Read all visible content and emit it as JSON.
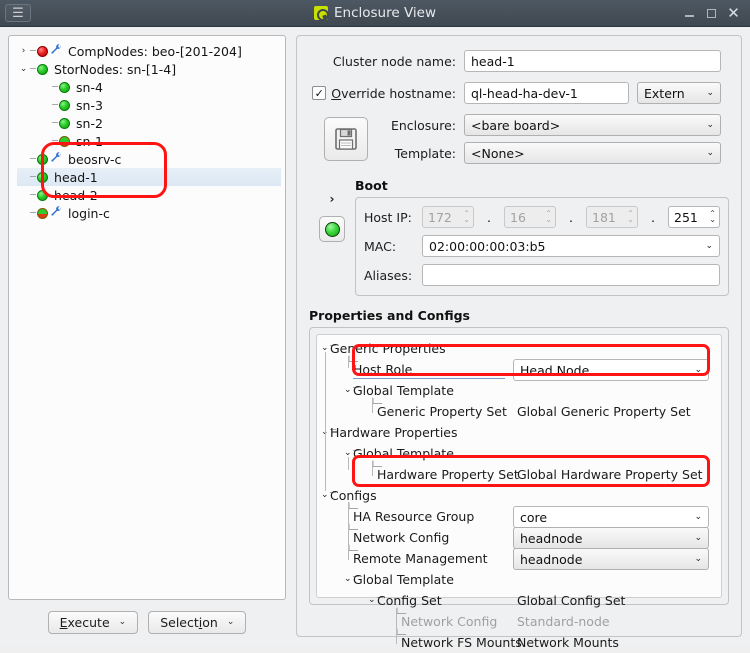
{
  "window": {
    "title": "Enclosure View",
    "app_icon": "qt-logo-icon",
    "menu_icon": "hamburger-menu-icon",
    "minimize_label": "_",
    "maximize_label": "□",
    "close_label": "✕"
  },
  "tree": {
    "nodes": [
      {
        "label": "CompNodes: beo-[201-204]",
        "arrow": "›",
        "led": "red",
        "wrench": true,
        "depth": 0,
        "selected": false
      },
      {
        "label": "StorNodes: sn-[1-4]",
        "arrow": "⌄",
        "led": "green",
        "wrench": false,
        "depth": 0,
        "selected": false
      },
      {
        "label": "sn-4",
        "arrow": "",
        "led": "green",
        "wrench": false,
        "depth": 1,
        "selected": false
      },
      {
        "label": "sn-3",
        "arrow": "",
        "led": "green",
        "wrench": false,
        "depth": 1,
        "selected": false
      },
      {
        "label": "sn-2",
        "arrow": "",
        "led": "green",
        "wrench": false,
        "depth": 1,
        "selected": false
      },
      {
        "label": "sn-1",
        "arrow": "",
        "led": "half",
        "wrench": false,
        "depth": 1,
        "selected": false
      },
      {
        "label": "beosrv-c",
        "arrow": "",
        "led": "green",
        "wrench": true,
        "depth": 0,
        "selected": false
      },
      {
        "label": "head-1",
        "arrow": "",
        "led": "green",
        "wrench": false,
        "depth": 0,
        "selected": true
      },
      {
        "label": "head-2",
        "arrow": "",
        "led": "green",
        "wrench": false,
        "depth": 0,
        "selected": false
      },
      {
        "label": "login-c",
        "arrow": "",
        "led": "half",
        "wrench": true,
        "depth": 0,
        "selected": false
      }
    ],
    "buttons": {
      "execute": "Execute",
      "execute_mnemonic": "E",
      "selection": "Selection",
      "selection_mnemonic": "i",
      "caret": "⌄"
    }
  },
  "form": {
    "cluster_node_name_label": "Cluster node name:",
    "cluster_node_name_value": "head-1",
    "override_hostname_label": "Override hostname:",
    "override_hostname_mnemonic": "O",
    "override_hostname_checked": "✓",
    "override_hostname_value": "ql-head-ha-dev-1",
    "override_scope_value": "Extern",
    "save_icon": "floppy-disk-save-icon",
    "enclosure_label": "Enclosure:",
    "enclosure_value": "<bare board>",
    "template_label": "Template:",
    "template_value": "<None>",
    "chevron": "⌄"
  },
  "boot": {
    "group_title": "Boot",
    "expand_arrow": "›",
    "status_led": "green-led-indicator",
    "host_ip_label": "Host IP:",
    "host_ip_octets": [
      {
        "value": "172",
        "disabled": true
      },
      {
        "value": "16",
        "disabled": true
      },
      {
        "value": "181",
        "disabled": true
      },
      {
        "value": "251",
        "disabled": false
      }
    ],
    "ip_separator": ".",
    "mac_label": "MAC:",
    "mac_value": "02:00:00:00:03:b5",
    "aliases_label": "Aliases:",
    "aliases_value": "",
    "spin_up": "⌃",
    "spin_down": "⌄"
  },
  "properties": {
    "section_title": "Properties and Configs",
    "rows": [
      {
        "kind": "branch",
        "name": "Generic Properties",
        "value": "",
        "depth": 0,
        "chevron": "⌄",
        "grey": false
      },
      {
        "kind": "editor",
        "name": "Host Role",
        "value": "Head Node",
        "depth": 1,
        "chevron": "",
        "grey": false,
        "combo": "white"
      },
      {
        "kind": "branch",
        "name": "Global Template",
        "value": "",
        "depth": 1,
        "chevron": "⌄",
        "grey": false
      },
      {
        "kind": "leaf",
        "name": "Generic Property Set",
        "value": "Global Generic Property Set",
        "depth": 2,
        "chevron": "",
        "grey": false
      },
      {
        "kind": "branch",
        "name": "Hardware Properties",
        "value": "",
        "depth": 0,
        "chevron": "⌄",
        "grey": false
      },
      {
        "kind": "branch",
        "name": "Global Template",
        "value": "",
        "depth": 1,
        "chevron": "⌄",
        "grey": false
      },
      {
        "kind": "leaf",
        "name": "Hardware Property Set",
        "value": "Global Hardware Property Set",
        "depth": 2,
        "chevron": "",
        "grey": false
      },
      {
        "kind": "branch",
        "name": "Configs",
        "value": "",
        "depth": 0,
        "chevron": "⌄",
        "grey": false
      },
      {
        "kind": "editor",
        "name": "HA Resource Group",
        "value": "core",
        "depth": 1,
        "chevron": "",
        "grey": false,
        "combo": "white"
      },
      {
        "kind": "editor",
        "name": "Network Config",
        "value": "headnode",
        "depth": 1,
        "chevron": "",
        "grey": false,
        "combo": "grey"
      },
      {
        "kind": "editor",
        "name": "Remote Management",
        "value": "headnode",
        "depth": 1,
        "chevron": "",
        "grey": false,
        "combo": "grey"
      },
      {
        "kind": "branch",
        "name": "Global Template",
        "value": "",
        "depth": 1,
        "chevron": "⌄",
        "grey": false
      },
      {
        "kind": "branch",
        "name": "Config Set",
        "value": "Global Config Set",
        "depth": 2,
        "chevron": "⌄",
        "grey": false
      },
      {
        "kind": "leaf",
        "name": "Network Config",
        "value": "Standard-node",
        "depth": 3,
        "chevron": "",
        "grey": true
      },
      {
        "kind": "leaf",
        "name": "Network FS Mounts",
        "value": "Network Mounts",
        "depth": 3,
        "chevron": "",
        "grey": false
      }
    ]
  },
  "annotations": {
    "color": "#ff1414",
    "boxes": [
      {
        "name": "tree-head-nodes-highlight"
      },
      {
        "name": "host-role-highlight"
      },
      {
        "name": "ha-resource-group-highlight"
      }
    ]
  }
}
